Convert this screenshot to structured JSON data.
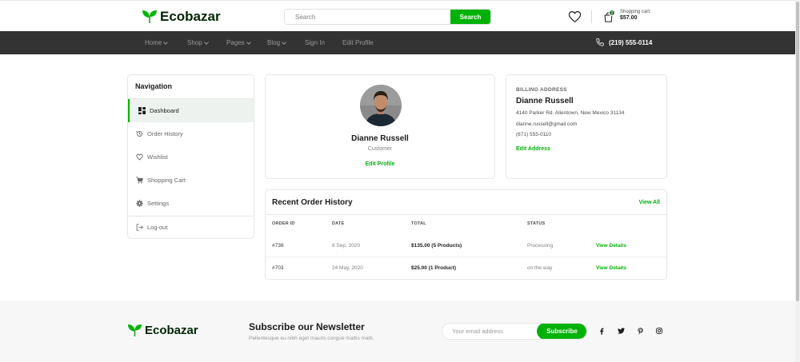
{
  "brand": {
    "name": "Ecobazar"
  },
  "search": {
    "placeholder": "Search",
    "button": "Search"
  },
  "cart": {
    "label": "Shopping cart:",
    "total": "$57.00",
    "count": "2"
  },
  "nav": {
    "items": [
      {
        "label": "Home",
        "dropdown": true
      },
      {
        "label": "Shop",
        "dropdown": true
      },
      {
        "label": "Pages",
        "dropdown": true
      },
      {
        "label": "Blog",
        "dropdown": true
      },
      {
        "label": "Sign In",
        "dropdown": false
      },
      {
        "label": "Edit Profile",
        "dropdown": false
      }
    ],
    "phone": "(219) 555-0114"
  },
  "sidebar": {
    "title": "Navigation",
    "items": [
      {
        "label": "Dashboard",
        "icon": "dashboard-icon",
        "active": true
      },
      {
        "label": "Order History",
        "icon": "history-icon"
      },
      {
        "label": "Wishlist",
        "icon": "heart-icon"
      },
      {
        "label": "Shopping Cart",
        "icon": "cart-icon"
      },
      {
        "label": "Settings",
        "icon": "gear-icon"
      },
      {
        "label": "Log-out",
        "icon": "logout-icon"
      }
    ]
  },
  "profile": {
    "name": "Dianne Russell",
    "role": "Customer",
    "edit": "Edit Profile"
  },
  "billing": {
    "title": "BILLING ADDRESS",
    "name": "Dianne Russell",
    "address": "4140 Parker Rd. Allentown, New Mexico 31134",
    "email": "dianne.russell@gmail.com",
    "phone": "(671) 555-0110",
    "edit": "Edit Address"
  },
  "orders": {
    "title": "Recent Order History",
    "view_all": "View All",
    "columns": [
      "ORDER ID",
      "DATE",
      "TOTAL",
      "STATUS"
    ],
    "rows": [
      {
        "id": "#738",
        "date": "8 Sep, 2020",
        "total": "$135.00 (5 Products)",
        "status": "Processing",
        "action": "View Details"
      },
      {
        "id": "#703",
        "date": "24 May, 2020",
        "total": "$25.00 (1 Product)",
        "status": "on the way",
        "action": "View Details"
      }
    ]
  },
  "newsletter": {
    "title": "Subscribe our Newsletter",
    "subtitle": "Pellentesque eu nibh eget mauris congue mattis matti.",
    "placeholder": "Your email address",
    "button": "Subscribe"
  },
  "social": [
    "facebook-icon",
    "twitter-icon",
    "pinterest-icon",
    "instagram-icon"
  ],
  "colors": {
    "primary": "#00b207",
    "dark_green": "#2c742f",
    "navbar": "#333333",
    "footer": "#f7f7f7"
  }
}
